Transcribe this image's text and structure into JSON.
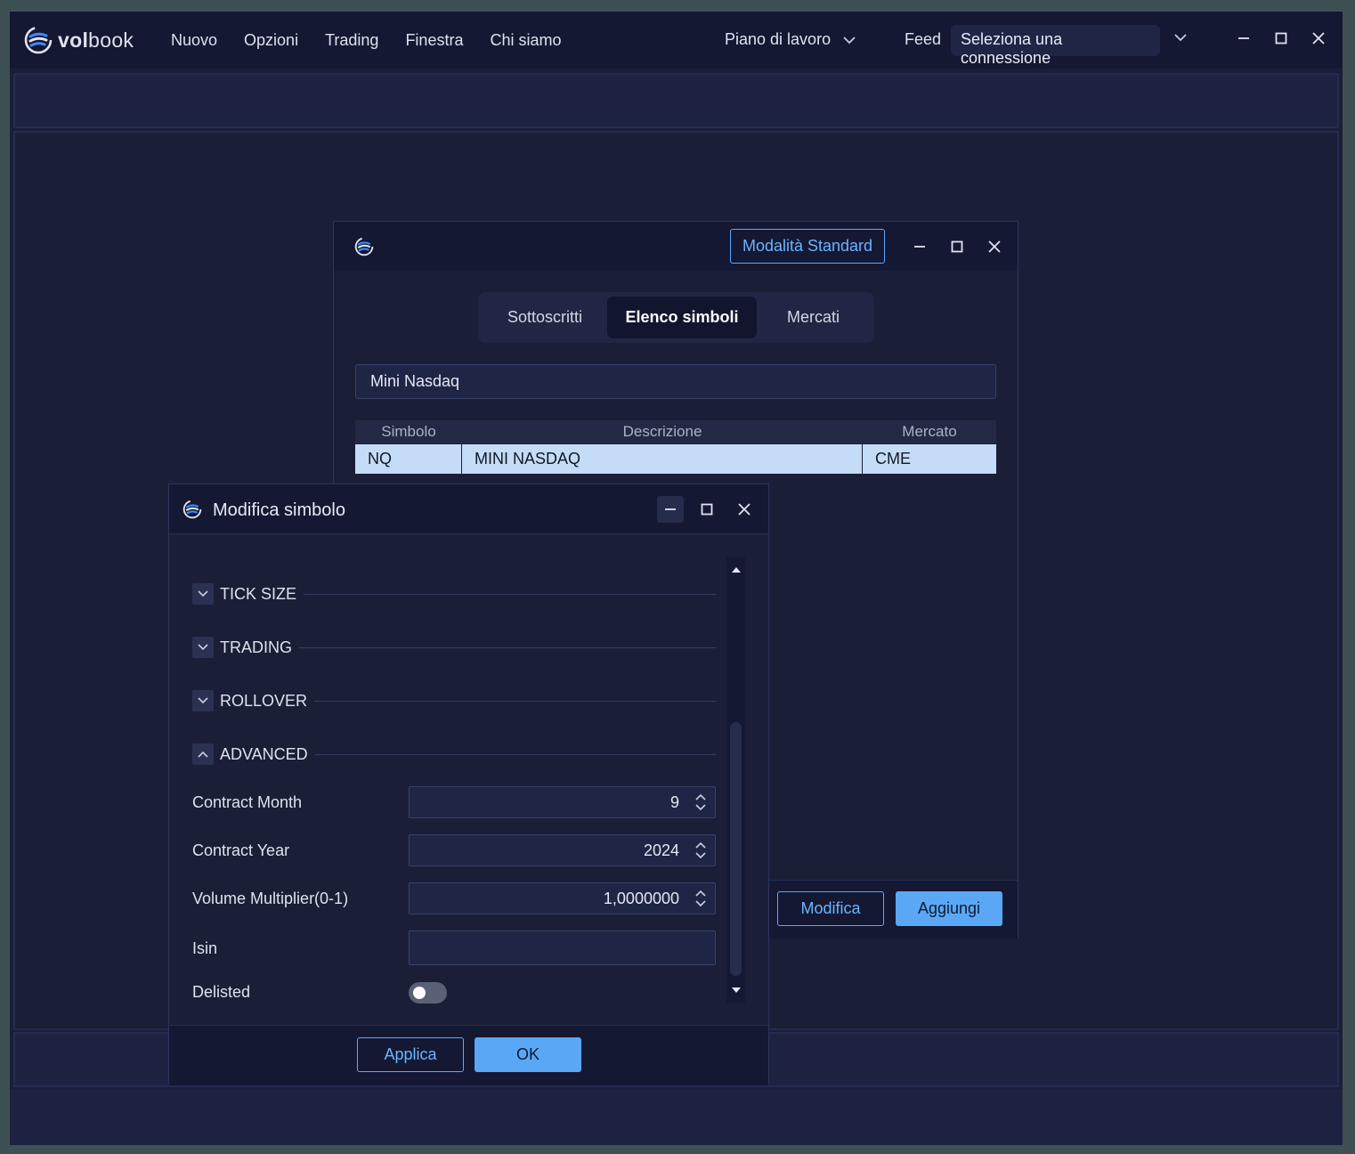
{
  "app": {
    "logo_text_bold": "vol",
    "logo_text": "book",
    "menu": [
      "Nuovo",
      "Opzioni",
      "Trading",
      "Finestra",
      "Chi siamo"
    ],
    "workspace_label": "Piano di lavoro",
    "feed_label": "Feed",
    "connection_value": "Seleziona una connessione"
  },
  "symbols_window": {
    "mode_button": "Modalità Standard",
    "tabs": [
      "Sottoscritti",
      "Elenco simboli",
      "Mercati"
    ],
    "active_tab": "Elenco simboli",
    "search_value": "Mini Nasdaq",
    "columns": [
      "Simbolo",
      "Descrizione",
      "Mercato"
    ],
    "rows": [
      {
        "symbol": "NQ",
        "description": "MINI NASDAQ",
        "market": "CME"
      }
    ],
    "modify_button": "Modifica",
    "add_button": "Aggiungi"
  },
  "edit_dialog": {
    "title": "Modifica simbolo",
    "sections": [
      "TICK SIZE",
      "TRADING",
      "ROLLOVER",
      "ADVANCED"
    ],
    "fields": {
      "contract_month_label": "Contract Month",
      "contract_month_value": "9",
      "contract_year_label": "Contract Year",
      "contract_year_value": "2024",
      "volume_multiplier_label": "Volume Multiplier(0-1)",
      "volume_multiplier_value": "1,0000000",
      "isin_label": "Isin",
      "isin_value": "",
      "delisted_label": "Delisted",
      "delisted_on": false
    },
    "apply_button": "Applica",
    "ok_button": "OK"
  },
  "colors": {
    "accent": "#5aa8f5",
    "background": "#1a1f37",
    "titlebar": "#141833",
    "selection": "#c5dcf8"
  }
}
